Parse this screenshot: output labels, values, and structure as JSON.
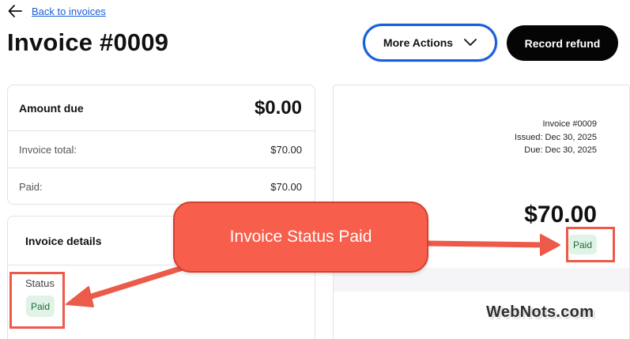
{
  "nav": {
    "back_label": "Back to invoices"
  },
  "header": {
    "title": "Invoice #0009",
    "more_actions_label": "More Actions",
    "record_refund_label": "Record refund"
  },
  "summary": {
    "amount_due_label": "Amount due",
    "amount_due_value": "$0.00",
    "invoice_total_label": "Invoice total:",
    "invoice_total_value": "$70.00",
    "paid_label": "Paid:",
    "paid_value": "$70.00"
  },
  "details": {
    "title": "Invoice details",
    "status_label": "Status",
    "status_value": "Paid"
  },
  "preview": {
    "invoice_number": "Invoice #0009",
    "issued": "Issued: Dec 30, 2025",
    "due": "Due: Dec 30, 2025",
    "amount": "$70.00",
    "status": "Paid"
  },
  "annotation": {
    "callout_text": "Invoice Status Paid",
    "highlight_color": "#ec5a4a"
  },
  "watermark": "WebNots.com",
  "colors": {
    "link": "#1a5fd6",
    "badge_bg": "#dff4e6",
    "badge_text": "#1e6b39",
    "callout": "#f85e4c"
  },
  "icons": {
    "back": "arrow-left-icon",
    "dropdown": "chevron-down-icon"
  }
}
